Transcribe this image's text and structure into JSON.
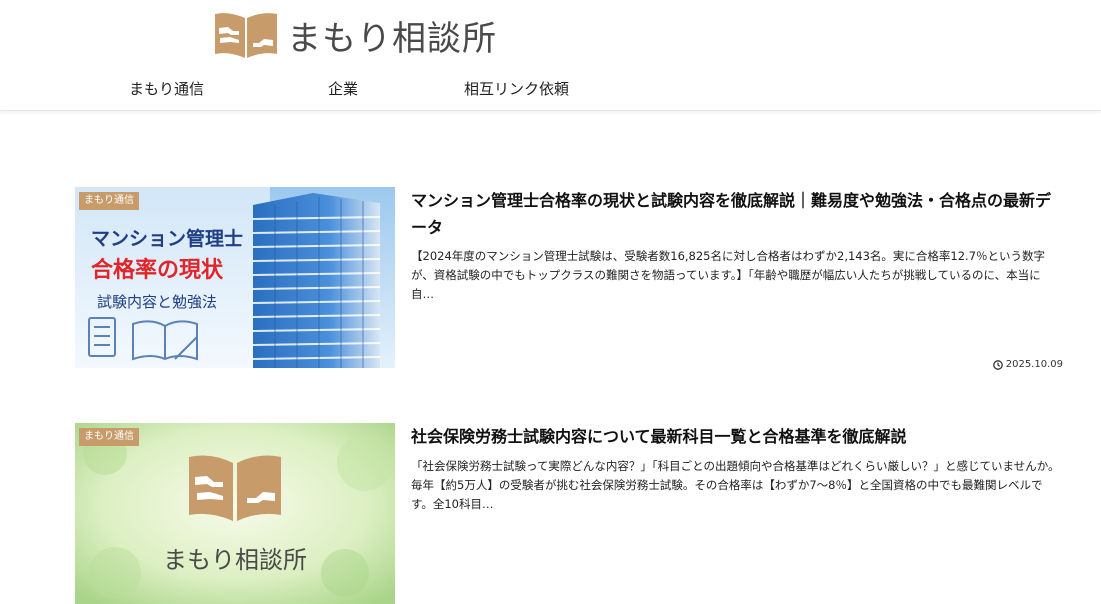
{
  "site": {
    "logo_text": "まもり相談所"
  },
  "nav": {
    "items": [
      "まもり通信",
      "企業",
      "相互リンク依頼"
    ]
  },
  "articles": [
    {
      "category": "まもり通信",
      "title": "マンション管理士合格率の現状と試験内容を徹底解説｜難易度や勉強法・合格点の最新データ",
      "excerpt": "【2024年度のマンション管理士試験は、受験者数16,825名に対し合格者はわずか2,143名。実に合格率12.7％という数字が、資格試験の中でもトップクラスの難関さを物語っています。】「年齢や職歴が幅広い人たちが挑戦しているのに、本当に自…",
      "date": "2025.10.09",
      "thumb": {
        "line1": "マンション管理士",
        "line2": "合格率の現状",
        "line3": "試験内容と勉強法"
      }
    },
    {
      "category": "まもり通信",
      "title": "社会保険労務士試験内容について最新科目一覧と合格基準を徹底解説",
      "excerpt": "「社会保険労務士試験って実際どんな内容？」「科目ごとの出題傾向や合格基準はどれくらい厳しい？」と感じていませんか。毎年【約5万人】の受験者が挑む社会保険労務士試験。その合格率は【わずか7～8％】と全国資格の中でも最難関レベルです。全10科目…",
      "thumb": {
        "logo_text": "まもり相談所"
      }
    }
  ],
  "colors": {
    "brand": "#c79c6a",
    "text": "#222222",
    "thumb1_red": "#e0262b",
    "thumb1_navy": "#1e3f86"
  },
  "icons": {
    "logo": "book-hands-icon",
    "date": "clock-icon"
  }
}
